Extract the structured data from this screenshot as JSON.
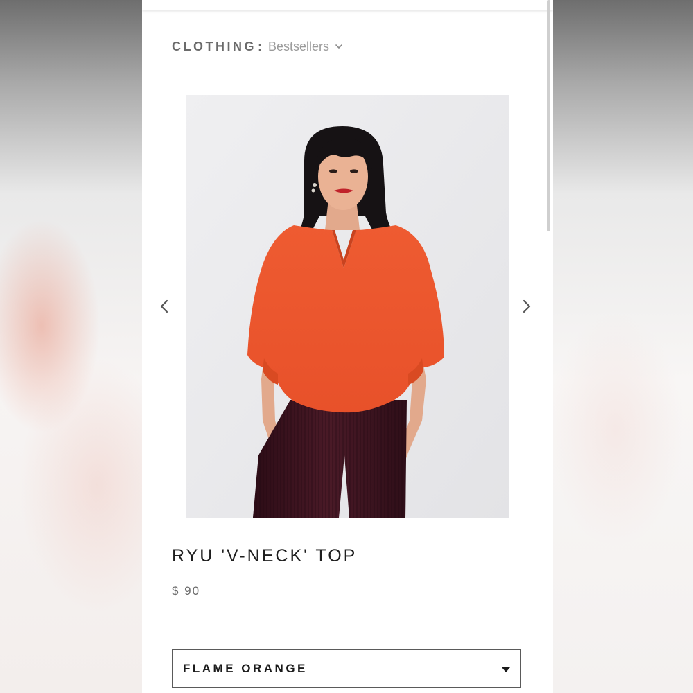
{
  "breadcrumb": {
    "category": "CLOTHING",
    "separator": ":",
    "collection": "Bestsellers",
    "chevron_icon": "chevron-down-icon"
  },
  "carousel": {
    "prev_icon": "chevron-left-icon",
    "next_icon": "chevron-right-icon"
  },
  "product": {
    "title": "RYU 'V-NECK' TOP",
    "price": "$ 90",
    "image_subject": "model wearing orange v-neck top"
  },
  "variant": {
    "selected": "FLAME ORANGE",
    "caret_icon": "caret-down-icon"
  },
  "colors": {
    "top": "#ef5a2f",
    "pants": "#3d1420",
    "text_dark": "#1f1f1f",
    "text_muted": "#9a9a9a"
  }
}
